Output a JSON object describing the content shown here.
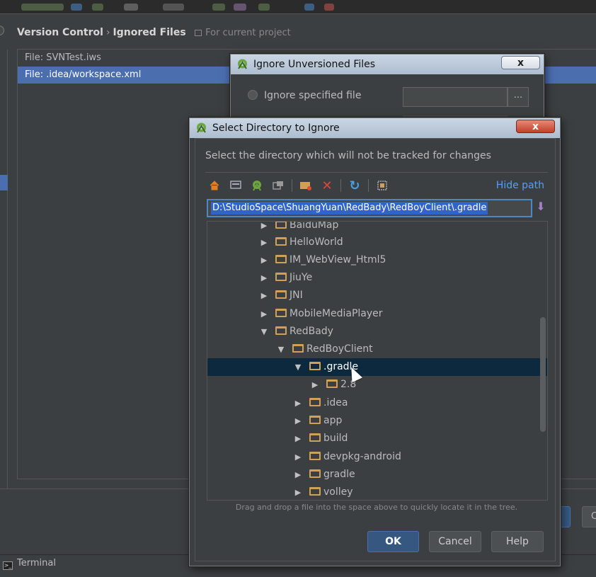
{
  "settings": {
    "breadcrumb_section": "Version Control",
    "breadcrumb_separator": "›",
    "breadcrumb_page": "Ignored Files",
    "scope_label": "For current project",
    "ignored_files": [
      "File: SVNTest.iws",
      "File: .idea/workspace.xml"
    ]
  },
  "ignore_dialog": {
    "title": "Ignore Unversioned Files",
    "close_label": "x",
    "option_label": "Ignore specified file",
    "browse_label": "..."
  },
  "select_dialog": {
    "title": "Select Directory to Ignore",
    "close_label": "x",
    "description": "Select the directory which will not be tracked for changes",
    "hide_path_label": "Hide path",
    "path_value": "D:\\StudioSpace\\ShuangYuan\\RedBady\\RedBoyClient\\.gradle",
    "toolbar_icons": [
      "home-icon",
      "desktop-icon",
      "android-icon",
      "module-icon",
      "new-folder-icon",
      "delete-icon",
      "refresh-icon",
      "show-hidden-icon"
    ],
    "tree": [
      {
        "label": "BaiduMap",
        "expanded": false
      },
      {
        "label": "HelloWorld",
        "expanded": false
      },
      {
        "label": "IM_WebView_Html5",
        "expanded": false
      },
      {
        "label": "JiuYe",
        "expanded": false
      },
      {
        "label": "JNI",
        "expanded": false
      },
      {
        "label": "MobileMediaPlayer",
        "expanded": false
      },
      {
        "label": "RedBady",
        "expanded": true
      },
      {
        "label": "RedBoyClient",
        "expanded": true
      },
      {
        "label": ".gradle",
        "expanded": true,
        "selected": true
      },
      {
        "label": "2.8",
        "expanded": false
      },
      {
        "label": ".idea",
        "expanded": false
      },
      {
        "label": "app",
        "expanded": false
      },
      {
        "label": "build",
        "expanded": false
      },
      {
        "label": "devpkg-android",
        "expanded": false
      },
      {
        "label": "gradle",
        "expanded": false
      },
      {
        "label": "volley",
        "expanded": false
      }
    ],
    "hint": "Drag and drop a file into the space above to quickly locate it in the tree.",
    "ok_label": "OK",
    "cancel_label": "Cancel",
    "help_label": "Help"
  },
  "bottom": {
    "right_button_label": "C",
    "terminal_label": "Terminal"
  }
}
